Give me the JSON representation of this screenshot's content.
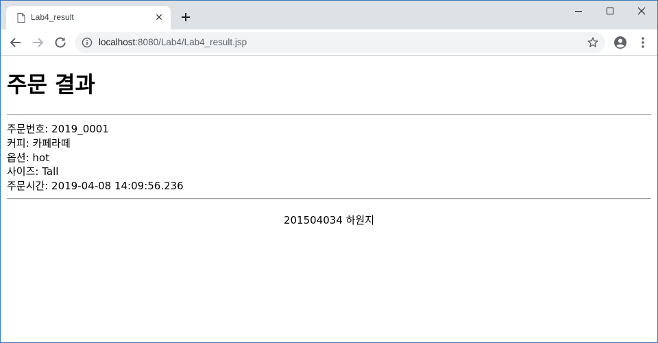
{
  "browser": {
    "tab": {
      "title": "Lab4_result",
      "icon": "document-icon",
      "close_glyph": "✕"
    },
    "address_bar": {
      "host": "localhost",
      "rest": ":8080/Lab4/Lab4_result.jsp"
    },
    "icons": [
      "back-arrow-icon",
      "forward-arrow-icon",
      "reload-icon",
      "info-icon",
      "star-icon",
      "profile-icon",
      "menu-dots-icon",
      "plus-icon",
      "minimize-icon",
      "maximize-icon",
      "close-icon"
    ]
  },
  "page": {
    "title": "주문 결과",
    "order": {
      "number": "주문번호: 2019_0001",
      "coffee": "커피: 카페라떼",
      "option": "옵션: hot",
      "size": "사이즈: Tall",
      "time": "주문시간: 2019-04-08 14:09:56.236"
    },
    "footer": "201504034 하원지"
  }
}
